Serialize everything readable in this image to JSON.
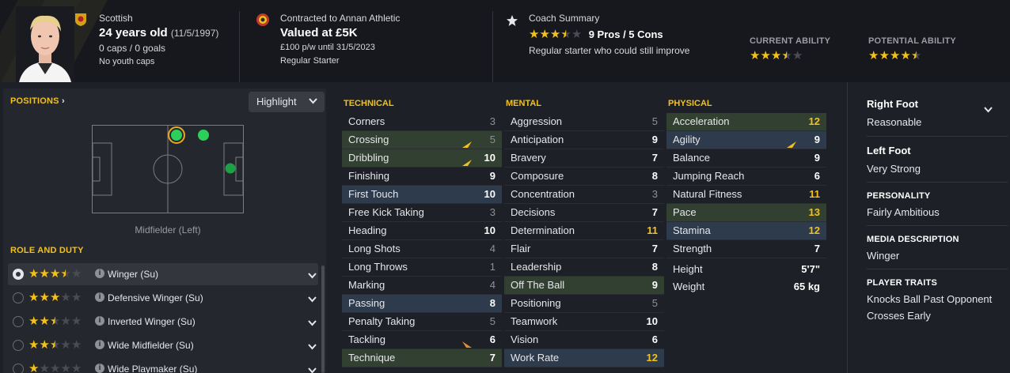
{
  "header": {
    "nationality": "Scottish",
    "age": "24 years old",
    "dob": "(11/5/1997)",
    "caps": "0 caps / 0 goals",
    "youth_caps": "No youth caps",
    "contract_to": "Contracted to Annan Athletic",
    "value": "Valued at £5K",
    "wage": "£100 p/w until 31/5/2023",
    "squad_status": "Regular Starter",
    "coach_title": "Coach Summary",
    "coach_stars": 3.5,
    "pros_cons": "9 Pros / 5 Cons",
    "coach_summary": "Regular starter who could still improve",
    "current_ability_label": "CURRENT ABILITY",
    "current_ability_stars": 3.5,
    "potential_ability_label": "POTENTIAL ABILITY",
    "potential_ability_stars": 4.5
  },
  "positions": {
    "title": "POSITIONS",
    "highlight_label": "Highlight",
    "position_label": "Midfielder (Left)"
  },
  "roles": {
    "title": "ROLE AND DUTY",
    "items": [
      {
        "name": "Winger (Su)",
        "stars": 3.5,
        "selected": true
      },
      {
        "name": "Defensive Winger (Su)",
        "stars": 3,
        "selected": false
      },
      {
        "name": "Inverted Winger (Su)",
        "stars": 2.5,
        "selected": false
      },
      {
        "name": "Wide Midfielder (Su)",
        "stars": 2.5,
        "selected": false
      },
      {
        "name": "Wide Playmaker (Su)",
        "stars": 1,
        "selected": false
      }
    ]
  },
  "technical": {
    "title": "TECHNICAL",
    "items": [
      {
        "name": "Corners",
        "value": "3"
      },
      {
        "name": "Crossing",
        "value": "5"
      },
      {
        "name": "Dribbling",
        "value": "10"
      },
      {
        "name": "Finishing",
        "value": "9"
      },
      {
        "name": "First Touch",
        "value": "10"
      },
      {
        "name": "Free Kick Taking",
        "value": "3"
      },
      {
        "name": "Heading",
        "value": "10"
      },
      {
        "name": "Long Shots",
        "value": "4"
      },
      {
        "name": "Long Throws",
        "value": "1"
      },
      {
        "name": "Marking",
        "value": "4"
      },
      {
        "name": "Passing",
        "value": "8"
      },
      {
        "name": "Penalty Taking",
        "value": "5"
      },
      {
        "name": "Tackling",
        "value": "6"
      },
      {
        "name": "Technique",
        "value": "7"
      }
    ]
  },
  "mental": {
    "title": "MENTAL",
    "items": [
      {
        "name": "Aggression",
        "value": "5"
      },
      {
        "name": "Anticipation",
        "value": "9"
      },
      {
        "name": "Bravery",
        "value": "7"
      },
      {
        "name": "Composure",
        "value": "8"
      },
      {
        "name": "Concentration",
        "value": "3"
      },
      {
        "name": "Decisions",
        "value": "7"
      },
      {
        "name": "Determination",
        "value": "11"
      },
      {
        "name": "Flair",
        "value": "7"
      },
      {
        "name": "Leadership",
        "value": "8"
      },
      {
        "name": "Off The Ball",
        "value": "9"
      },
      {
        "name": "Positioning",
        "value": "5"
      },
      {
        "name": "Teamwork",
        "value": "10"
      },
      {
        "name": "Vision",
        "value": "6"
      },
      {
        "name": "Work Rate",
        "value": "12"
      }
    ]
  },
  "physical": {
    "title": "PHYSICAL",
    "items": [
      {
        "name": "Acceleration",
        "value": "12"
      },
      {
        "name": "Agility",
        "value": "9"
      },
      {
        "name": "Balance",
        "value": "9"
      },
      {
        "name": "Jumping Reach",
        "value": "6"
      },
      {
        "name": "Natural Fitness",
        "value": "11"
      },
      {
        "name": "Pace",
        "value": "13"
      },
      {
        "name": "Stamina",
        "value": "12"
      },
      {
        "name": "Strength",
        "value": "7"
      }
    ],
    "height_label": "Height",
    "height": "5'7\"",
    "weight_label": "Weight",
    "weight": "65 kg"
  },
  "profile": {
    "right_foot_label": "Right Foot",
    "right_foot": "Reasonable",
    "left_foot_label": "Left Foot",
    "left_foot": "Very Strong",
    "personality_label": "PERSONALITY",
    "personality": "Fairly Ambitious",
    "media_label": "MEDIA DESCRIPTION",
    "media": "Winger",
    "traits_label": "PLAYER TRAITS",
    "traits": [
      "Knocks Ball Past Opponent",
      "Crosses Early"
    ]
  },
  "colors": {
    "accent": "#f2c21b",
    "positive_row": "#324032",
    "negative_row": "#2d3b4c",
    "background": "#1e2028"
  }
}
